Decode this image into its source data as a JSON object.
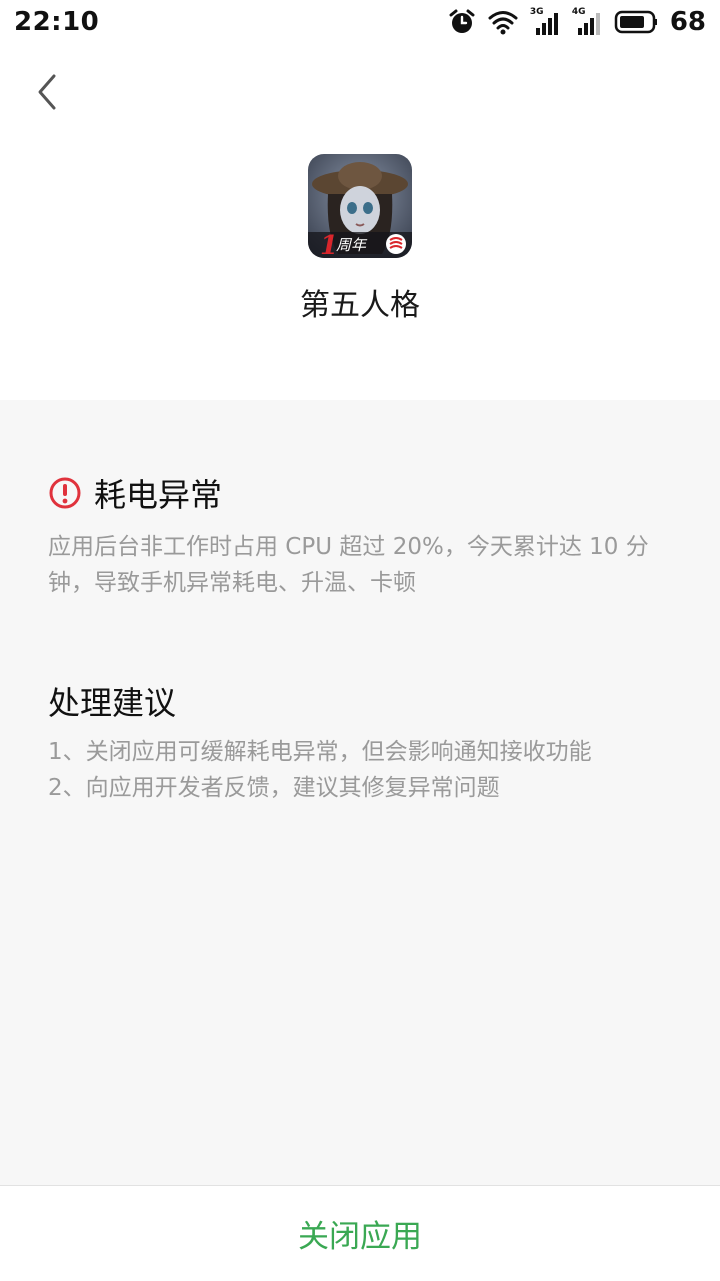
{
  "status_bar": {
    "time": "22:10",
    "net1_label": "3G",
    "net2_label": "4G",
    "battery_percent": "68"
  },
  "header": {
    "app_name": "第五人格",
    "icon_badge": "1周年"
  },
  "anomaly": {
    "title": "耗电异常",
    "description": "应用后台非工作时占用 CPU 超过 20%，今天累计达 10 分钟，导致手机异常耗电、升温、卡顿"
  },
  "suggestions": {
    "title": "处理建议",
    "items": [
      "1、关闭应用可缓解耗电异常，但会影响通知接收功能",
      "2、向应用开发者反馈，建议其修复异常问题"
    ]
  },
  "actions": {
    "close_app_label": "关闭应用"
  },
  "colors": {
    "accent_green": "#3aa853",
    "warning_red": "#e0323c",
    "secondary_text": "#9a9a9a",
    "panel_bg": "#f7f7f7"
  },
  "icons": [
    "back-arrow-icon",
    "alarm-icon",
    "wifi-icon",
    "signal-icon",
    "battery-icon",
    "warning-icon"
  ]
}
